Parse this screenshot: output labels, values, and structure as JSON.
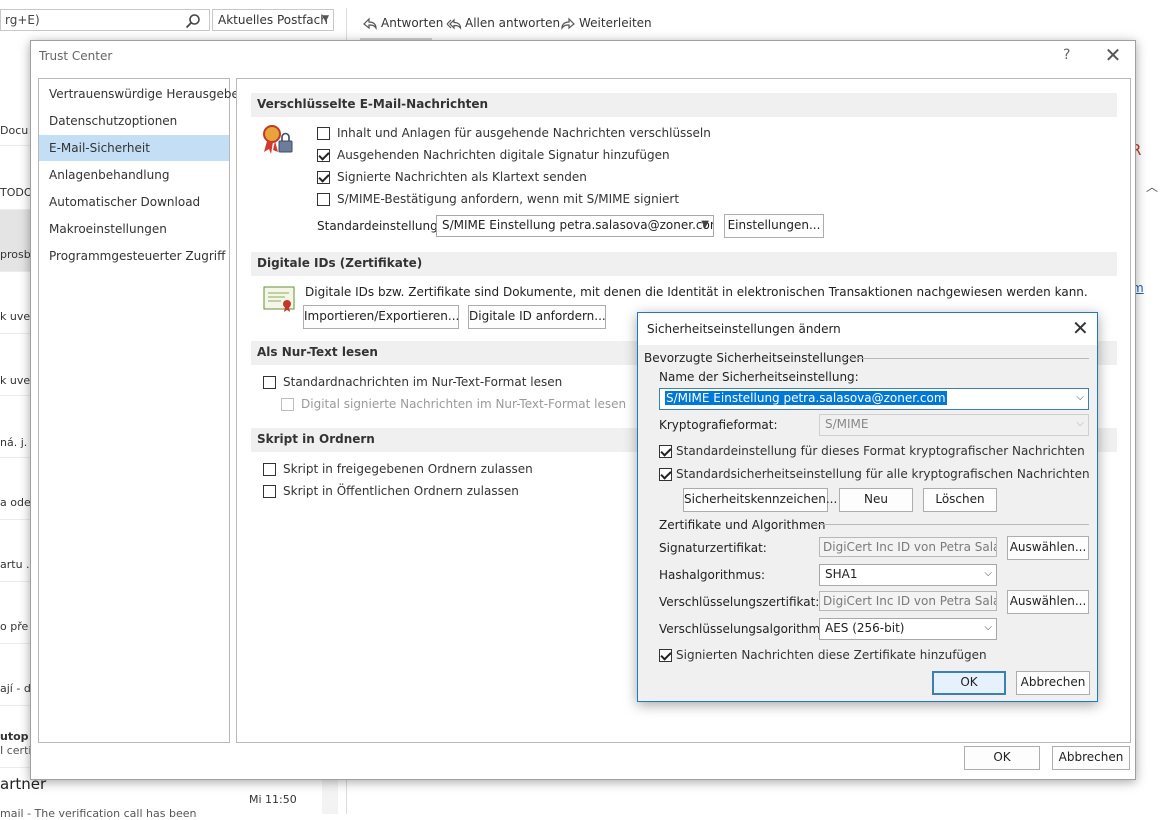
{
  "outlook": {
    "search_text": "rg+E)",
    "search_scope": "Aktuelles Postfach",
    "toolbar": {
      "reply": "Antworten",
      "reply_all": "Allen antworten",
      "forward": "Weiterleiten"
    },
    "mail_fragments": [
      "Docu",
      "TODO",
      "prosb",
      "k uve",
      "k uve",
      "ná. j.",
      "a ode",
      "artu .",
      "o pře",
      "ají - d",
      "utop",
      "I certi"
    ],
    "partner": "artner",
    "time": "Mi 11:50",
    "preview": "mail - The verification call has been",
    "link_fragment": "m"
  },
  "trust_center": {
    "title": "Trust Center",
    "help": "?",
    "close": "✕",
    "nav": [
      "Vertrauenswürdige Herausgeber",
      "Datenschutzoptionen",
      "E-Mail-Sicherheit",
      "Anlagenbehandlung",
      "Automatischer Download",
      "Makroeinstellungen",
      "Programmgesteuerter Zugriff"
    ],
    "selected_nav": "E-Mail-Sicherheit",
    "sec_encrypted": {
      "title": "Verschlüsselte E-Mail-Nachrichten",
      "options": [
        {
          "label": "Inhalt und Anlagen für ausgehende Nachrichten verschlüsseln",
          "checked": false
        },
        {
          "label": "Ausgehenden Nachrichten digitale Signatur hinzufügen",
          "checked": true
        },
        {
          "label": "Signierte Nachrichten als Klartext senden",
          "checked": true
        },
        {
          "label": "S/MIME-Bestätigung anfordern, wenn mit S/MIME signiert",
          "checked": false
        }
      ],
      "default_label": "Standardeinstellung:",
      "default_value": "S/MIME Einstellung petra.salasova@zoner.com",
      "settings_button": "Einstellungen..."
    },
    "sec_digital_ids": {
      "title": "Digitale IDs (Zertifikate)",
      "description": "Digitale IDs bzw. Zertifikate sind Dokumente, mit denen die Identität in elektronischen Transaktionen nachgewiesen werden kann.",
      "import_button": "Importieren/Exportieren...",
      "request_button": "Digitale ID anfordern..."
    },
    "sec_plaintext": {
      "title": "Als Nur-Text lesen",
      "option1": "Standardnachrichten im Nur-Text-Format lesen",
      "option2": "Digital signierte Nachrichten im Nur-Text-Format lesen"
    },
    "sec_script": {
      "title": "Skript in Ordnern",
      "option1": "Skript in freigegebenen Ordnern zulassen",
      "option2": "Skript in Öffentlichen Ordnern zulassen"
    },
    "ok": "OK",
    "cancel": "Abbrechen"
  },
  "security_dialog": {
    "title": "Sicherheitseinstellungen ändern",
    "close": "✕",
    "group_preferred": "Bevorzugte Sicherheitseinstellungen",
    "name_label": "Name der Sicherheitseinstellung:",
    "name_value": "S/MIME Einstellung petra.salasova@zoner.com",
    "crypto_label": "Kryptografieformat:",
    "crypto_value": "S/MIME",
    "check_default_format": "Standardeinstellung für dieses Format kryptografischer Nachrichten",
    "check_default_all": "Standardsicherheitseinstellung für alle kryptografischen Nachrichten",
    "btn_labels": "Sicherheitskennzeichen...",
    "btn_new": "Neu",
    "btn_delete": "Löschen",
    "group_certs": "Zertifikate und Algorithmen",
    "sign_cert_label": "Signaturzertifikat:",
    "sign_cert_value": "DigiCert Inc ID von Petra Salašová",
    "hash_label": "Hashalgorithmus:",
    "hash_value": "SHA1",
    "enc_cert_label": "Verschlüsselungszertifikat:",
    "enc_cert_value": "DigiCert Inc ID von Petra Salašová",
    "enc_alg_label": "Verschlüsselungsalgorithmus:",
    "enc_alg_value": "AES (256-bit)",
    "choose": "Auswählen...",
    "check_add_certs": "Signierten Nachrichten diese Zertifikate hinzufügen",
    "ok": "OK",
    "cancel": "Abbrechen"
  }
}
